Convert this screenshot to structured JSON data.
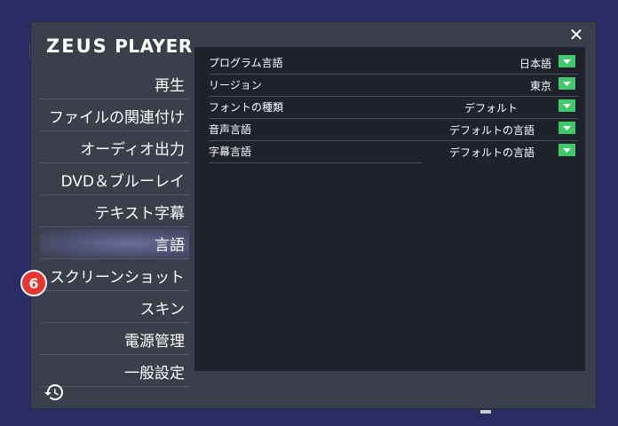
{
  "app": {
    "logo_bold": "ZEUS",
    "logo_rest": " PLAYER"
  },
  "window": {
    "close_label": "✕"
  },
  "sidebar": {
    "items": [
      {
        "label": "再生"
      },
      {
        "label": "ファイルの関連付け"
      },
      {
        "label": "オーディオ出力"
      },
      {
        "label": "DVD＆ブルーレイ"
      },
      {
        "label": "テキスト字幕"
      },
      {
        "label": "言語",
        "active": true
      },
      {
        "label": "スクリーンショット"
      },
      {
        "label": "スキン"
      },
      {
        "label": "電源管理"
      },
      {
        "label": "一般設定"
      }
    ],
    "badge": "6",
    "history_icon": "history-icon"
  },
  "settings": {
    "rows": [
      {
        "label": "プログラム言語",
        "value": "日本語"
      },
      {
        "label": "リージョン",
        "value": "東京"
      },
      {
        "label": "フォントの種類",
        "value": "デフォルト"
      },
      {
        "label": "音声言語",
        "value": "デフォルトの言語"
      },
      {
        "label": "字幕言語",
        "value": "デフォルトの言語"
      }
    ]
  },
  "colors": {
    "background": "#2a2d63",
    "dialog": "#3b3e4b",
    "panel": "#1f212d",
    "dropdown_accent": "#3ec96b",
    "badge": "#e8332e"
  }
}
